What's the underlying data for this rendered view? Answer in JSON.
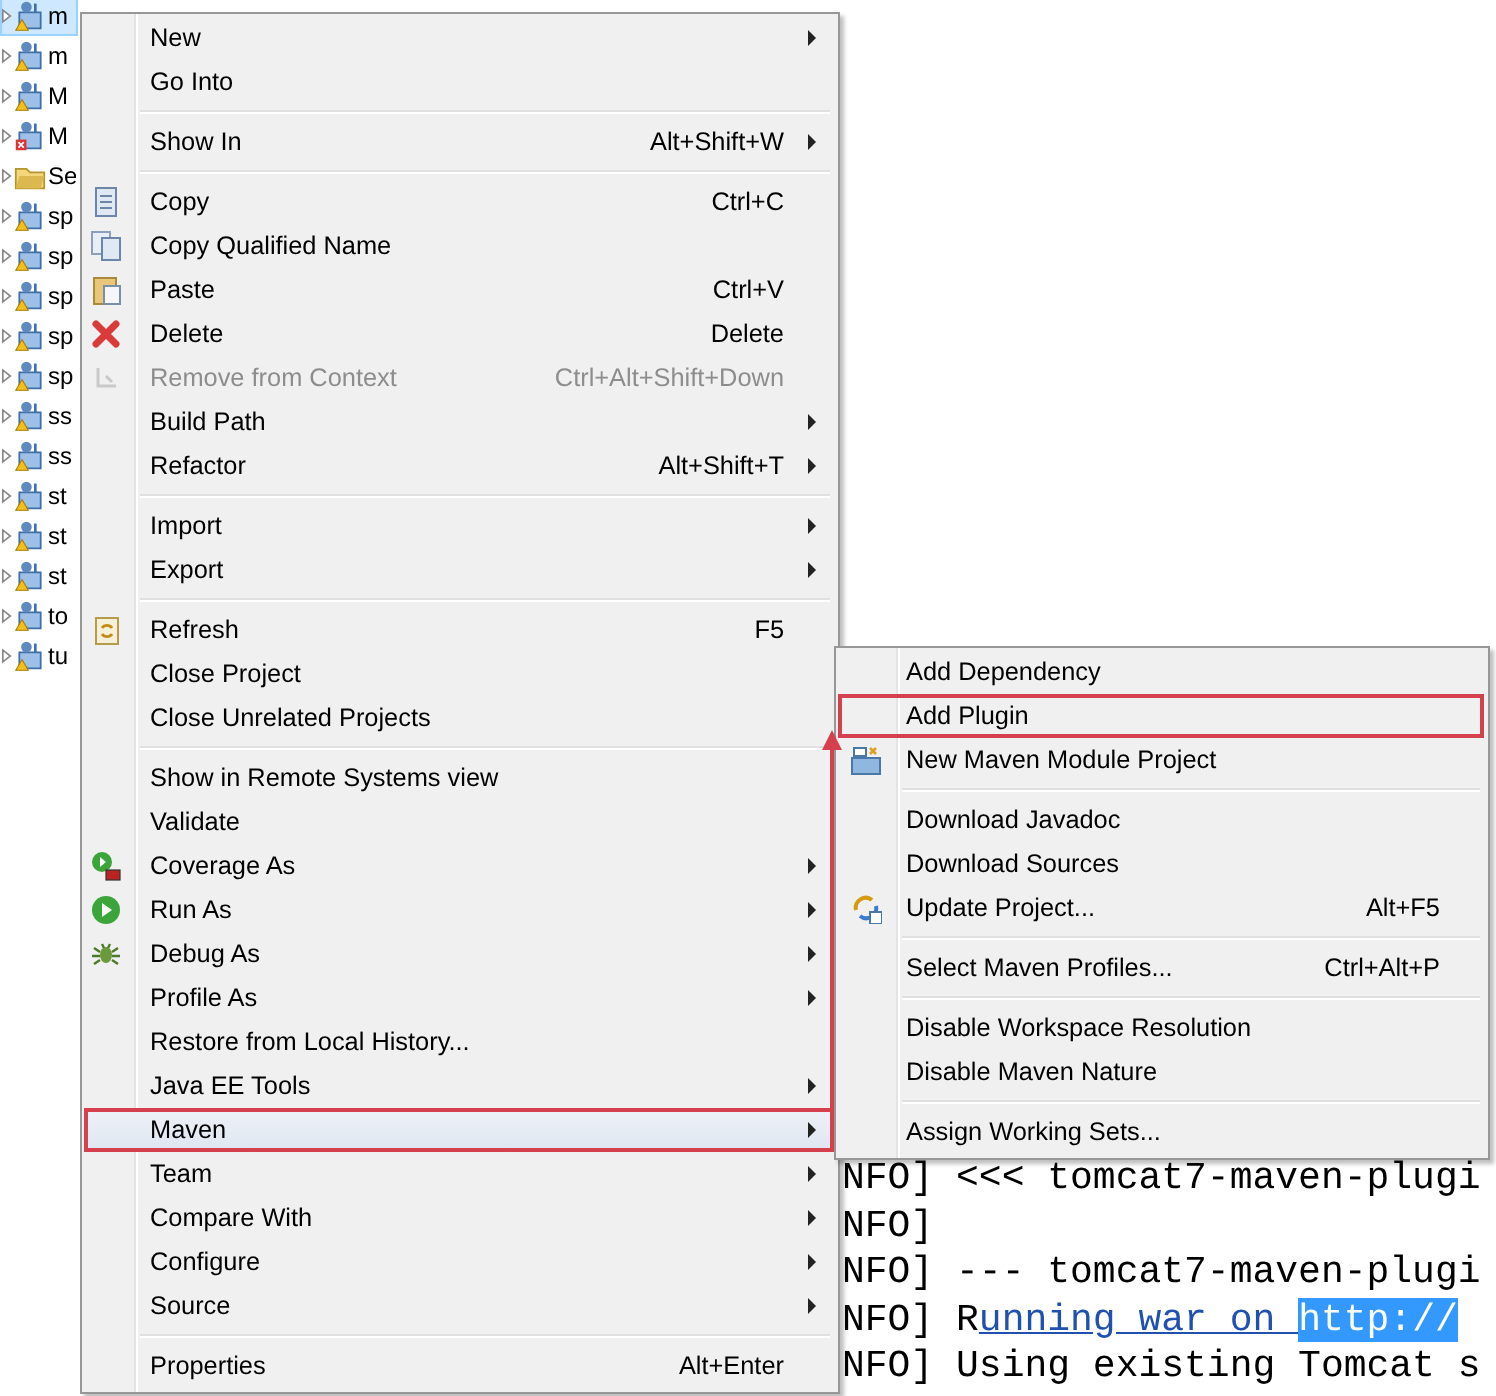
{
  "tree": {
    "items": [
      {
        "label": "m",
        "kind": "project",
        "selected": true
      },
      {
        "label": "m",
        "kind": "project",
        "selected": false
      },
      {
        "label": "M",
        "kind": "project",
        "selected": false
      },
      {
        "label": "M",
        "kind": "broken",
        "selected": false
      },
      {
        "label": "Se",
        "kind": "folder",
        "selected": false
      },
      {
        "label": "sp",
        "kind": "project",
        "selected": false
      },
      {
        "label": "sp",
        "kind": "project",
        "selected": false
      },
      {
        "label": "sp",
        "kind": "project",
        "selected": false
      },
      {
        "label": "sp",
        "kind": "project",
        "selected": false
      },
      {
        "label": "sp",
        "kind": "project",
        "selected": false
      },
      {
        "label": "ss",
        "kind": "project",
        "selected": false
      },
      {
        "label": "ss",
        "kind": "project",
        "selected": false
      },
      {
        "label": "st",
        "kind": "project",
        "selected": false
      },
      {
        "label": "st",
        "kind": "project",
        "selected": false
      },
      {
        "label": "st",
        "kind": "project",
        "selected": false
      },
      {
        "label": "to",
        "kind": "project",
        "selected": false
      },
      {
        "label": "tu",
        "kind": "project",
        "selected": false
      }
    ]
  },
  "console": {
    "lines": [
      [
        {
          "text": "NFO] <<< tomcat7-maven-plugi",
          "kind": "plain"
        }
      ],
      [
        {
          "text": "NFO]",
          "kind": "plain"
        }
      ],
      [
        {
          "text": "NFO] --- tomcat7-maven-plugi",
          "kind": "plain"
        }
      ],
      [
        {
          "text": "NFO] R",
          "kind": "plain"
        },
        {
          "text": "unning war on ",
          "kind": "link"
        },
        {
          "text": "http://",
          "kind": "selection"
        }
      ],
      [
        {
          "text": "NFO] Using existing Tomcat s",
          "kind": "plain"
        }
      ]
    ]
  },
  "main_menu": {
    "items": [
      {
        "kind": "item",
        "label": "New",
        "submenu": true,
        "disabled": false,
        "selected": false,
        "highlighted": false
      },
      {
        "kind": "item",
        "label": "Go Into",
        "submenu": false,
        "disabled": false,
        "selected": false,
        "highlighted": false
      },
      {
        "kind": "separator"
      },
      {
        "kind": "item",
        "label": "Show In",
        "shortcut": "Alt+Shift+W",
        "submenu": true,
        "disabled": false,
        "selected": false,
        "highlighted": false
      },
      {
        "kind": "separator"
      },
      {
        "kind": "item",
        "label": "Copy",
        "shortcut": "Ctrl+C",
        "submenu": false,
        "disabled": false,
        "selected": false,
        "highlighted": false
      },
      {
        "kind": "item",
        "label": "Copy Qualified Name",
        "submenu": false,
        "disabled": false,
        "selected": false,
        "highlighted": false
      },
      {
        "kind": "item",
        "label": "Paste",
        "shortcut": "Ctrl+V",
        "submenu": false,
        "disabled": false,
        "selected": false,
        "highlighted": false
      },
      {
        "kind": "item",
        "label": "Delete",
        "shortcut": "Delete",
        "submenu": false,
        "disabled": false,
        "selected": false,
        "highlighted": false
      },
      {
        "kind": "item",
        "label": "Remove from Context",
        "shortcut": "Ctrl+Alt+Shift+Down",
        "submenu": false,
        "disabled": true,
        "selected": false,
        "highlighted": false
      },
      {
        "kind": "item",
        "label": "Build Path",
        "submenu": true,
        "disabled": false,
        "selected": false,
        "highlighted": false
      },
      {
        "kind": "item",
        "label": "Refactor",
        "shortcut": "Alt+Shift+T",
        "submenu": true,
        "disabled": false,
        "selected": false,
        "highlighted": false
      },
      {
        "kind": "separator"
      },
      {
        "kind": "item",
        "label": "Import",
        "submenu": true,
        "disabled": false,
        "selected": false,
        "highlighted": false
      },
      {
        "kind": "item",
        "label": "Export",
        "submenu": true,
        "disabled": false,
        "selected": false,
        "highlighted": false
      },
      {
        "kind": "separator"
      },
      {
        "kind": "item",
        "label": "Refresh",
        "shortcut": "F5",
        "submenu": false,
        "disabled": false,
        "selected": false,
        "highlighted": false
      },
      {
        "kind": "item",
        "label": "Close Project",
        "submenu": false,
        "disabled": false,
        "selected": false,
        "highlighted": false
      },
      {
        "kind": "item",
        "label": "Close Unrelated Projects",
        "submenu": false,
        "disabled": false,
        "selected": false,
        "highlighted": false
      },
      {
        "kind": "separator"
      },
      {
        "kind": "item",
        "label": "Show in Remote Systems view",
        "submenu": false,
        "disabled": false,
        "selected": false,
        "highlighted": false
      },
      {
        "kind": "item",
        "label": "Validate",
        "submenu": false,
        "disabled": false,
        "selected": false,
        "highlighted": false
      },
      {
        "kind": "item",
        "label": "Coverage As",
        "submenu": true,
        "disabled": false,
        "selected": false,
        "highlighted": false
      },
      {
        "kind": "item",
        "label": "Run As",
        "submenu": true,
        "disabled": false,
        "selected": false,
        "highlighted": false
      },
      {
        "kind": "item",
        "label": "Debug As",
        "submenu": true,
        "disabled": false,
        "selected": false,
        "highlighted": false
      },
      {
        "kind": "item",
        "label": "Profile As",
        "submenu": true,
        "disabled": false,
        "selected": false,
        "highlighted": false
      },
      {
        "kind": "item",
        "label": "Restore from Local History...",
        "submenu": false,
        "disabled": false,
        "selected": false,
        "highlighted": false
      },
      {
        "kind": "item",
        "label": "Java EE Tools",
        "submenu": true,
        "disabled": false,
        "selected": false,
        "highlighted": false
      },
      {
        "kind": "item",
        "label": "Maven",
        "submenu": true,
        "disabled": false,
        "selected": true,
        "highlighted": true
      },
      {
        "kind": "item",
        "label": "Team",
        "submenu": true,
        "disabled": false,
        "selected": false,
        "highlighted": false
      },
      {
        "kind": "item",
        "label": "Compare With",
        "submenu": true,
        "disabled": false,
        "selected": false,
        "highlighted": false
      },
      {
        "kind": "item",
        "label": "Configure",
        "submenu": true,
        "disabled": false,
        "selected": false,
        "highlighted": false
      },
      {
        "kind": "item",
        "label": "Source",
        "submenu": true,
        "disabled": false,
        "selected": false,
        "highlighted": false
      },
      {
        "kind": "separator"
      },
      {
        "kind": "item",
        "label": "Properties",
        "shortcut": "Alt+Enter",
        "submenu": false,
        "disabled": false,
        "selected": false,
        "highlighted": false
      }
    ]
  },
  "maven_submenu": {
    "items": [
      {
        "kind": "item",
        "label": "Add Dependency",
        "submenu": false,
        "disabled": false,
        "selected": false,
        "highlighted": false
      },
      {
        "kind": "item",
        "label": "Add Plugin",
        "submenu": false,
        "disabled": false,
        "selected": false,
        "highlighted": true
      },
      {
        "kind": "item",
        "label": "New Maven Module Project",
        "submenu": false,
        "disabled": false,
        "selected": false,
        "highlighted": false
      },
      {
        "kind": "separator"
      },
      {
        "kind": "item",
        "label": "Download Javadoc",
        "submenu": false,
        "disabled": false,
        "selected": false,
        "highlighted": false
      },
      {
        "kind": "item",
        "label": "Download Sources",
        "submenu": false,
        "disabled": false,
        "selected": false,
        "highlighted": false
      },
      {
        "kind": "item",
        "label": "Update Project...",
        "shortcut": "Alt+F5",
        "submenu": false,
        "disabled": false,
        "selected": false,
        "highlighted": false
      },
      {
        "kind": "separator"
      },
      {
        "kind": "item",
        "label": "Select Maven Profiles...",
        "shortcut": "Ctrl+Alt+P",
        "submenu": false,
        "disabled": false,
        "selected": false,
        "highlighted": false
      },
      {
        "kind": "separator"
      },
      {
        "kind": "item",
        "label": "Disable Workspace Resolution",
        "submenu": false,
        "disabled": false,
        "selected": false,
        "highlighted": false
      },
      {
        "kind": "item",
        "label": "Disable Maven Nature",
        "submenu": false,
        "disabled": false,
        "selected": false,
        "highlighted": false
      },
      {
        "kind": "separator"
      },
      {
        "kind": "item",
        "label": "Assign Working Sets...",
        "submenu": false,
        "disabled": false,
        "selected": false,
        "highlighted": false
      }
    ]
  }
}
